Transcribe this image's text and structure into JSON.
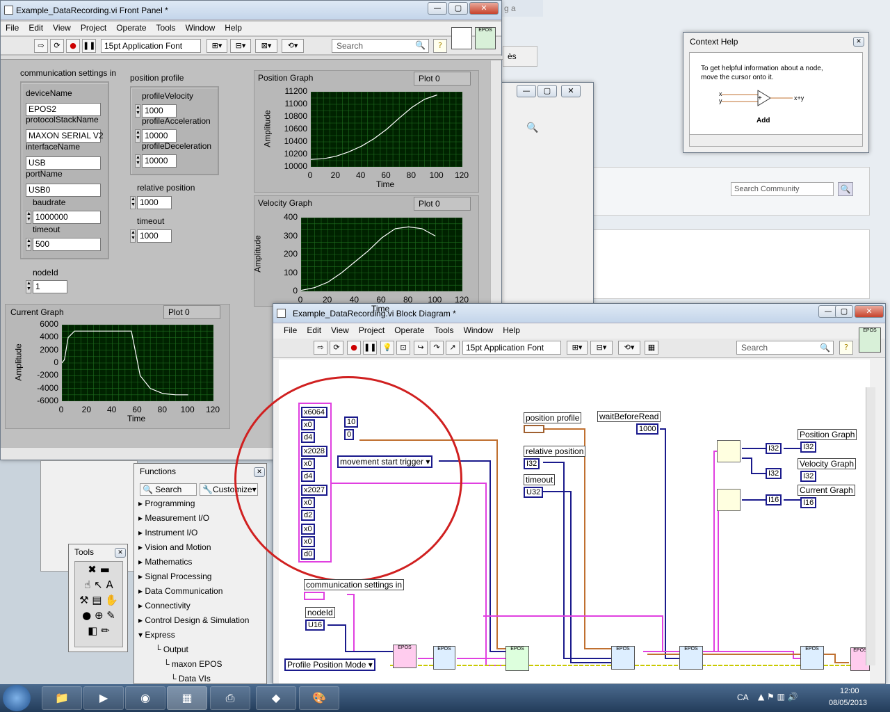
{
  "front_panel": {
    "title": "Example_DataRecording.vi Front Panel *",
    "menu": [
      "File",
      "Edit",
      "View",
      "Project",
      "Operate",
      "Tools",
      "Window",
      "Help"
    ],
    "font_select": "15pt Application Font",
    "search_placeholder": "Search",
    "comm_label": "communication settings in",
    "deviceName_label": "deviceName",
    "deviceName": "EPOS2",
    "protocol_label": "protocolStackName",
    "protocol": "MAXON SERIAL V2",
    "interface_label": "interfaceName",
    "interface": "USB",
    "port_label": "portName",
    "port": "USB0",
    "baud_label": "baudrate",
    "baud": "1000000",
    "timeout_label": "timeout",
    "timeout": "500",
    "nodeid_label": "nodeId",
    "nodeid": "1",
    "profile_label": "position profile",
    "pv_label": "profileVelocity",
    "pv": "1000",
    "pa_label": "profileAcceleration",
    "pa": "10000",
    "pd_label": "profileDeceleration",
    "pd": "10000",
    "relpos_label": "relative position",
    "relpos": "1000",
    "timeout2_label": "timeout",
    "timeout2": "1000",
    "plot_legend": "Plot 0",
    "amplitude": "Amplitude",
    "time": "Time"
  },
  "chart_data": [
    {
      "type": "line",
      "title": "Position  Graph",
      "xlabel": "Time",
      "ylabel": "Amplitude",
      "xlim": [
        0,
        120
      ],
      "ylim": [
        10000,
        11200
      ],
      "xticks": [
        "0",
        "20",
        "40",
        "60",
        "80",
        "100",
        "120"
      ],
      "yticks": [
        "11200",
        "11000",
        "10800",
        "10600",
        "10400",
        "10200",
        "10000"
      ],
      "series": [
        {
          "name": "Plot 0",
          "x": [
            0,
            10,
            20,
            30,
            40,
            50,
            60,
            70,
            80,
            90,
            100
          ],
          "y": [
            10120,
            10130,
            10170,
            10240,
            10330,
            10450,
            10600,
            10780,
            10950,
            11080,
            11150
          ]
        }
      ]
    },
    {
      "type": "line",
      "title": "Velocity Graph",
      "xlabel": "Time",
      "ylabel": "Amplitude",
      "xlim": [
        0,
        120
      ],
      "ylim": [
        0,
        400
      ],
      "xticks": [
        "0",
        "20",
        "40",
        "60",
        "80",
        "100",
        "120"
      ],
      "yticks": [
        "400",
        "300",
        "200",
        "100",
        "0"
      ],
      "series": [
        {
          "name": "Plot 0",
          "x": [
            0,
            10,
            20,
            30,
            40,
            50,
            60,
            70,
            80,
            90,
            100
          ],
          "y": [
            5,
            20,
            50,
            100,
            160,
            220,
            290,
            340,
            350,
            340,
            300
          ]
        }
      ]
    },
    {
      "type": "line",
      "title": "Current Graph",
      "xlabel": "Time",
      "ylabel": "Amplitude",
      "xlim": [
        0,
        120
      ],
      "ylim": [
        -6000,
        6000
      ],
      "xticks": [
        "0",
        "20",
        "40",
        "60",
        "80",
        "100",
        "120"
      ],
      "yticks": [
        "6000",
        "4000",
        "2000",
        "0",
        "-2000",
        "-4000",
        "-6000"
      ],
      "series": [
        {
          "name": "Plot 0",
          "x": [
            0,
            2,
            5,
            10,
            20,
            30,
            40,
            55,
            58,
            62,
            70,
            80,
            90,
            100
          ],
          "y": [
            0,
            500,
            4000,
            5000,
            5000,
            5000,
            5000,
            5000,
            2000,
            -2000,
            -4000,
            -4800,
            -5000,
            -5000
          ]
        }
      ]
    }
  ],
  "context_help": {
    "title": "Context Help",
    "text": "To get helpful information about a node, move the cursor onto it.",
    "node_x": "x",
    "node_y": "y",
    "node_out": "x+y",
    "node_name": "Add"
  },
  "browser": {
    "search_placeholder": "Search Community",
    "tab_text": "g a",
    "tab_text2": "ès"
  },
  "block_diagram": {
    "title": "Example_DataRecording.vi Block Diagram *",
    "menu": [
      "File",
      "Edit",
      "View",
      "Project",
      "Operate",
      "Tools",
      "Window",
      "Help"
    ],
    "font_select": "15pt Application Font",
    "search_placeholder": "Search",
    "const_6064": "x6064",
    "const_2028": "x2028",
    "const_2027": "x2027",
    "const_x0": "x0",
    "const_d4": "d4",
    "const_d2": "d2",
    "const_d0": "d0",
    "const_10": "10",
    "const_0": "0",
    "trigger": "movement start trigger",
    "position_profile": "position profile",
    "relative_position": "relative position",
    "timeout": "timeout",
    "wait": "waitBeforeRead",
    "wait_val": "1000",
    "pos_graph": "Position  Graph",
    "vel_graph": "Velocity Graph",
    "cur_graph": "Current Graph",
    "comm_settings": "communication settings in",
    "nodeid": "nodeId",
    "mode": "Profile Position Mode",
    "i32": "I32",
    "i16": "I16",
    "u32": "U32",
    "u16": "U16",
    "epos": "EPOS"
  },
  "functions_palette": {
    "title": "Functions",
    "search": "Search",
    "customize": "Customize",
    "items": [
      "Programming",
      "Measurement I/O",
      "Instrument I/O",
      "Vision and Motion",
      "Mathematics",
      "Signal Processing",
      "Data Communication",
      "Connectivity",
      "Control Design & Simulation",
      "Express"
    ],
    "sub": [
      "Output",
      "maxon EPOS",
      "Data VIs"
    ]
  },
  "tools_palette": {
    "title": "Tools"
  },
  "taskbar": {
    "lang": "CA",
    "time": "12:00",
    "date": "08/05/2013"
  },
  "colors": {
    "plot_bg": "#002200",
    "grid": "#1e6e1e",
    "trace": "#ffffff",
    "wire_orange": "#c07030",
    "wire_blue": "#1a1a8c",
    "wire_pink": "#e040e0",
    "circle": "#d02020"
  }
}
